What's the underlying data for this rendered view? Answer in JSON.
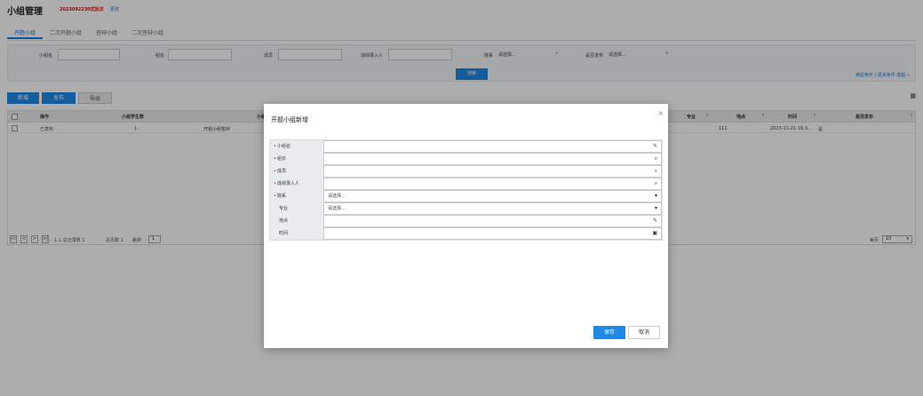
{
  "page": {
    "title": "小组管理",
    "batch": "2023092230式批次",
    "batch_change": "更改"
  },
  "tabs": [
    "开题小组",
    "二次开题小组",
    "答辩小组",
    "二次答辩小组"
  ],
  "filters": {
    "group_name": "小组名",
    "leader": "组长",
    "members": "成员",
    "grade_entry": "成绩录入人",
    "department": "院系",
    "department_value": "请选择...",
    "published": "是否发布",
    "published_value": "请选择..."
  },
  "search_button": "搜索",
  "more_links": "满足条件 | 更多条件  收起 »",
  "toolbar": {
    "add": "新增",
    "publish": "发布",
    "export": "导出"
  },
  "table": {
    "headers": [
      "操作",
      "小组学生数",
      "小组",
      "专业",
      "地点",
      "时间",
      "是否发布"
    ],
    "row": {
      "action": "已发布",
      "count": "1",
      "group": "开题小组答辩",
      "location": "111",
      "time": "2023-11-21 16:3...",
      "published": "是"
    }
  },
  "pager": {
    "summary": "1-1 总记录数 1",
    "pages": "总页数 1",
    "jump_label": "跳转",
    "jump_value": "1",
    "per_page_label": "每页",
    "per_page_value": "10"
  },
  "modal": {
    "title": "开题小组新增",
    "close": "×",
    "fields": [
      {
        "label": "小组名",
        "required": true,
        "value": "",
        "icon": "pencil-icon"
      },
      {
        "label": "组长",
        "required": true,
        "value": "",
        "icon": "search-icon"
      },
      {
        "label": "成员",
        "required": true,
        "value": "",
        "icon": "search-icon"
      },
      {
        "label": "成绩录入人",
        "required": true,
        "value": "",
        "icon": "search-icon"
      },
      {
        "label": "院系",
        "required": true,
        "value": "请选择...",
        "icon": "chevron-down-icon"
      },
      {
        "label": "专业",
        "required": false,
        "value": "请选择...",
        "icon": "chevron-down-icon"
      },
      {
        "label": "地点",
        "required": false,
        "value": "",
        "icon": "pencil-icon"
      },
      {
        "label": "时间",
        "required": false,
        "value": "",
        "icon": "calendar-icon"
      }
    ],
    "save": "保存",
    "cancel": "取消"
  }
}
